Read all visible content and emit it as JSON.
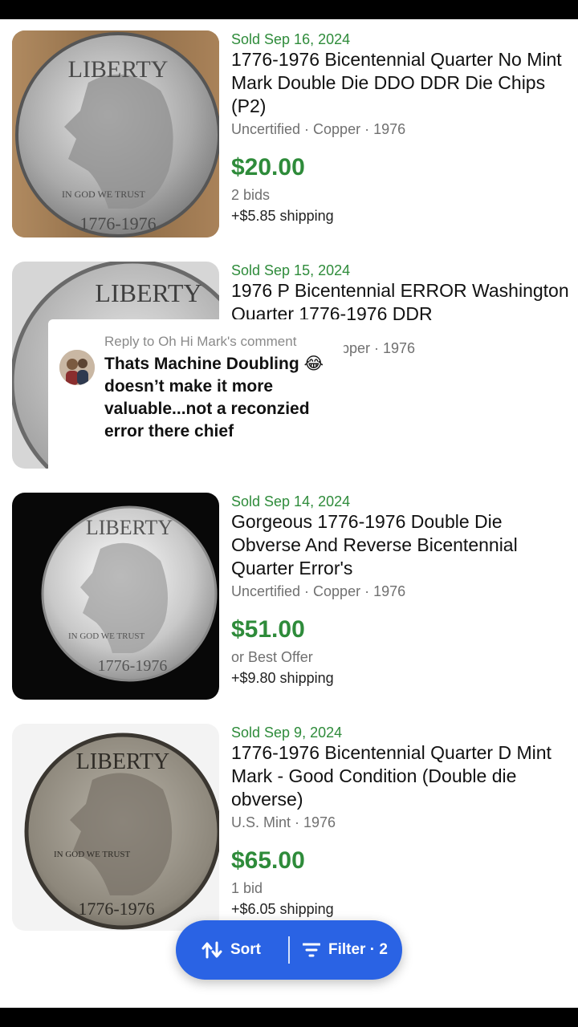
{
  "listings": [
    {
      "sold": "Sold  Sep 16, 2024",
      "title": "1776-1976 Bicentennial Quarter No Mint Mark Double Die DDO DDR Die Chips (P2)",
      "meta": "Uncertified · Copper · 1976",
      "price": "$20.00",
      "sub": "2 bids",
      "shipping": "+$5.85 shipping"
    },
    {
      "sold": "Sold  Sep 15, 2024",
      "title": "1976 P Bicentennial ERROR Washington Quarter  1776-1976  DDR",
      "meta": "pper · 1976",
      "price": "",
      "sub": "",
      "shipping": ""
    },
    {
      "sold": "Sold  Sep 14, 2024",
      "title": "Gorgeous 1776-1976 Double Die Obverse And Reverse Bicentennial Quarter  Error's",
      "meta": "Uncertified · Copper · 1976",
      "price": "$51.00",
      "sub": "or Best Offer",
      "shipping": "+$9.80 shipping"
    },
    {
      "sold": "Sold  Sep 9, 2024",
      "title": "1776-1976 Bicentennial Quarter D Mint Mark - Good Condition (Double die obverse)",
      "meta": "U.S. Mint · 1976",
      "price": "$65.00",
      "sub": "1 bid",
      "shipping": "+$6.05 shipping"
    }
  ],
  "coin_text": {
    "liberty": "LIBERTY",
    "motto": "IN GOD WE TRUST",
    "dates": "1776-1976"
  },
  "comment": {
    "reply_to": "Reply to Oh Hi Mark's comment",
    "text": "Thats Machine Doubling 😂doesn’t make it more valuable...not a reconzied error there chief"
  },
  "actions": {
    "sort_label": "Sort",
    "filter_label": "Filter · 2"
  },
  "colors": {
    "sold_green": "#2e8b3a",
    "pill_blue": "#2a63e4"
  }
}
